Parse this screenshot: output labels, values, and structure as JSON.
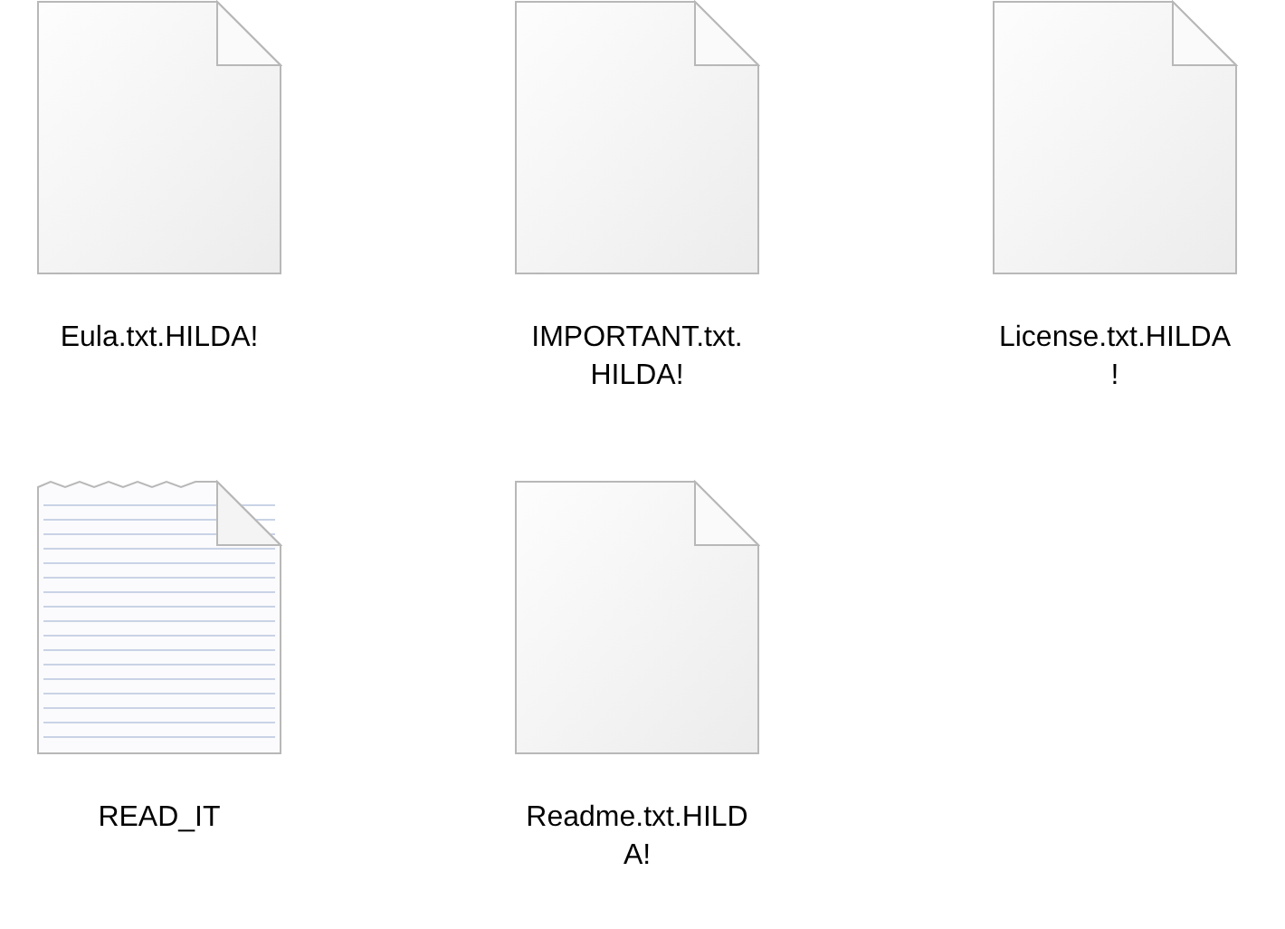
{
  "files": [
    {
      "kind": "blank",
      "name_lines": [
        "Eula.txt.HILDA!"
      ]
    },
    {
      "kind": "blank",
      "name_lines": [
        "IMPORTANT.txt.",
        "HILDA!"
      ]
    },
    {
      "kind": "blank",
      "name_lines": [
        "License.txt.HILDA",
        "!"
      ]
    },
    {
      "kind": "lined",
      "name_lines": [
        "READ_IT"
      ]
    },
    {
      "kind": "blank",
      "name_lines": [
        "Readme.txt.HILD",
        "A!"
      ]
    }
  ]
}
